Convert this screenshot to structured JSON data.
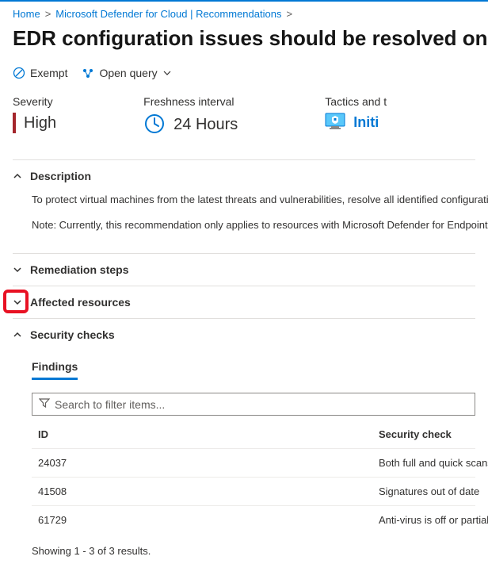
{
  "breadcrumb": {
    "items": [
      "Home",
      "Microsoft Defender for Cloud | Recommendations"
    ]
  },
  "title": "EDR configuration issues should be resolved on virtual m",
  "toolbar": {
    "exempt": "Exempt",
    "open_query": "Open query"
  },
  "metrics": {
    "severity": {
      "label": "Severity",
      "value": "High"
    },
    "freshness": {
      "label": "Freshness interval",
      "value": "24 Hours"
    },
    "tactics": {
      "label": "Tactics and t",
      "value": "Initi"
    }
  },
  "sections": {
    "description": {
      "title": "Description",
      "body1": "To protect virtual machines from the latest threats and vulnerabilities, resolve all identified configuration issue",
      "body2": "Note: Currently, this recommendation only applies to resources with Microsoft Defender for Endpoint (MDE) e"
    },
    "remediation": {
      "title": "Remediation steps"
    },
    "affected": {
      "title": "Affected resources"
    },
    "security_checks": {
      "title": "Security checks"
    }
  },
  "findings": {
    "title": "Findings",
    "search_placeholder": "Search to filter items...",
    "columns": {
      "id": "ID",
      "check": "Security check"
    },
    "rows": [
      {
        "id": "24037",
        "check": "Both full and quick scans a"
      },
      {
        "id": "41508",
        "check": "Signatures out of date"
      },
      {
        "id": "61729",
        "check": "Anti-virus is off or partially"
      }
    ],
    "results_text": "Showing 1 - 3 of 3 results."
  }
}
